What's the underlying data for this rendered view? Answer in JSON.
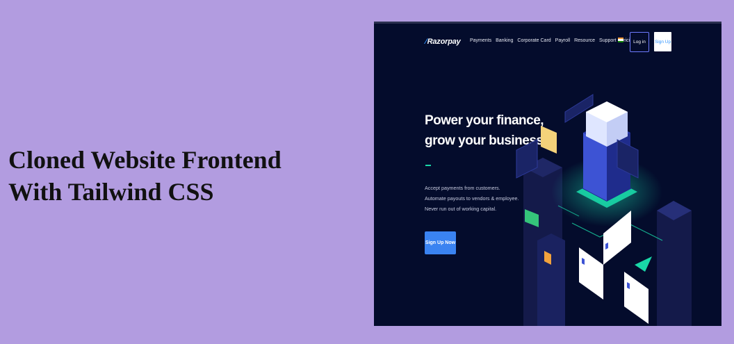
{
  "caption": {
    "line1": "Cloned Website Frontend",
    "line2": "With Tailwind CSS"
  },
  "site": {
    "logo": "Razorpay",
    "nav": [
      "Payments",
      "Banking",
      "Corporate Card",
      "Payroll",
      "Resource",
      "Support",
      "Pricing"
    ],
    "login": "Log in",
    "signup": "Sign Up",
    "headline_line1": "Power your finance,",
    "headline_line2": "grow your business",
    "description": "Accept payments from customers. Automate payouts to vendors & employee. Never run out of working capital.",
    "cta": "Sign Up Now"
  },
  "colors": {
    "page_bg": "#b29ce0",
    "site_bg": "#040c2c",
    "accent_blue": "#3395ff",
    "cta_blue": "#3a83f1",
    "accent_green": "#19d8a8"
  },
  "icons": [
    "razorpay-logo-mark",
    "india-flag-icon"
  ]
}
